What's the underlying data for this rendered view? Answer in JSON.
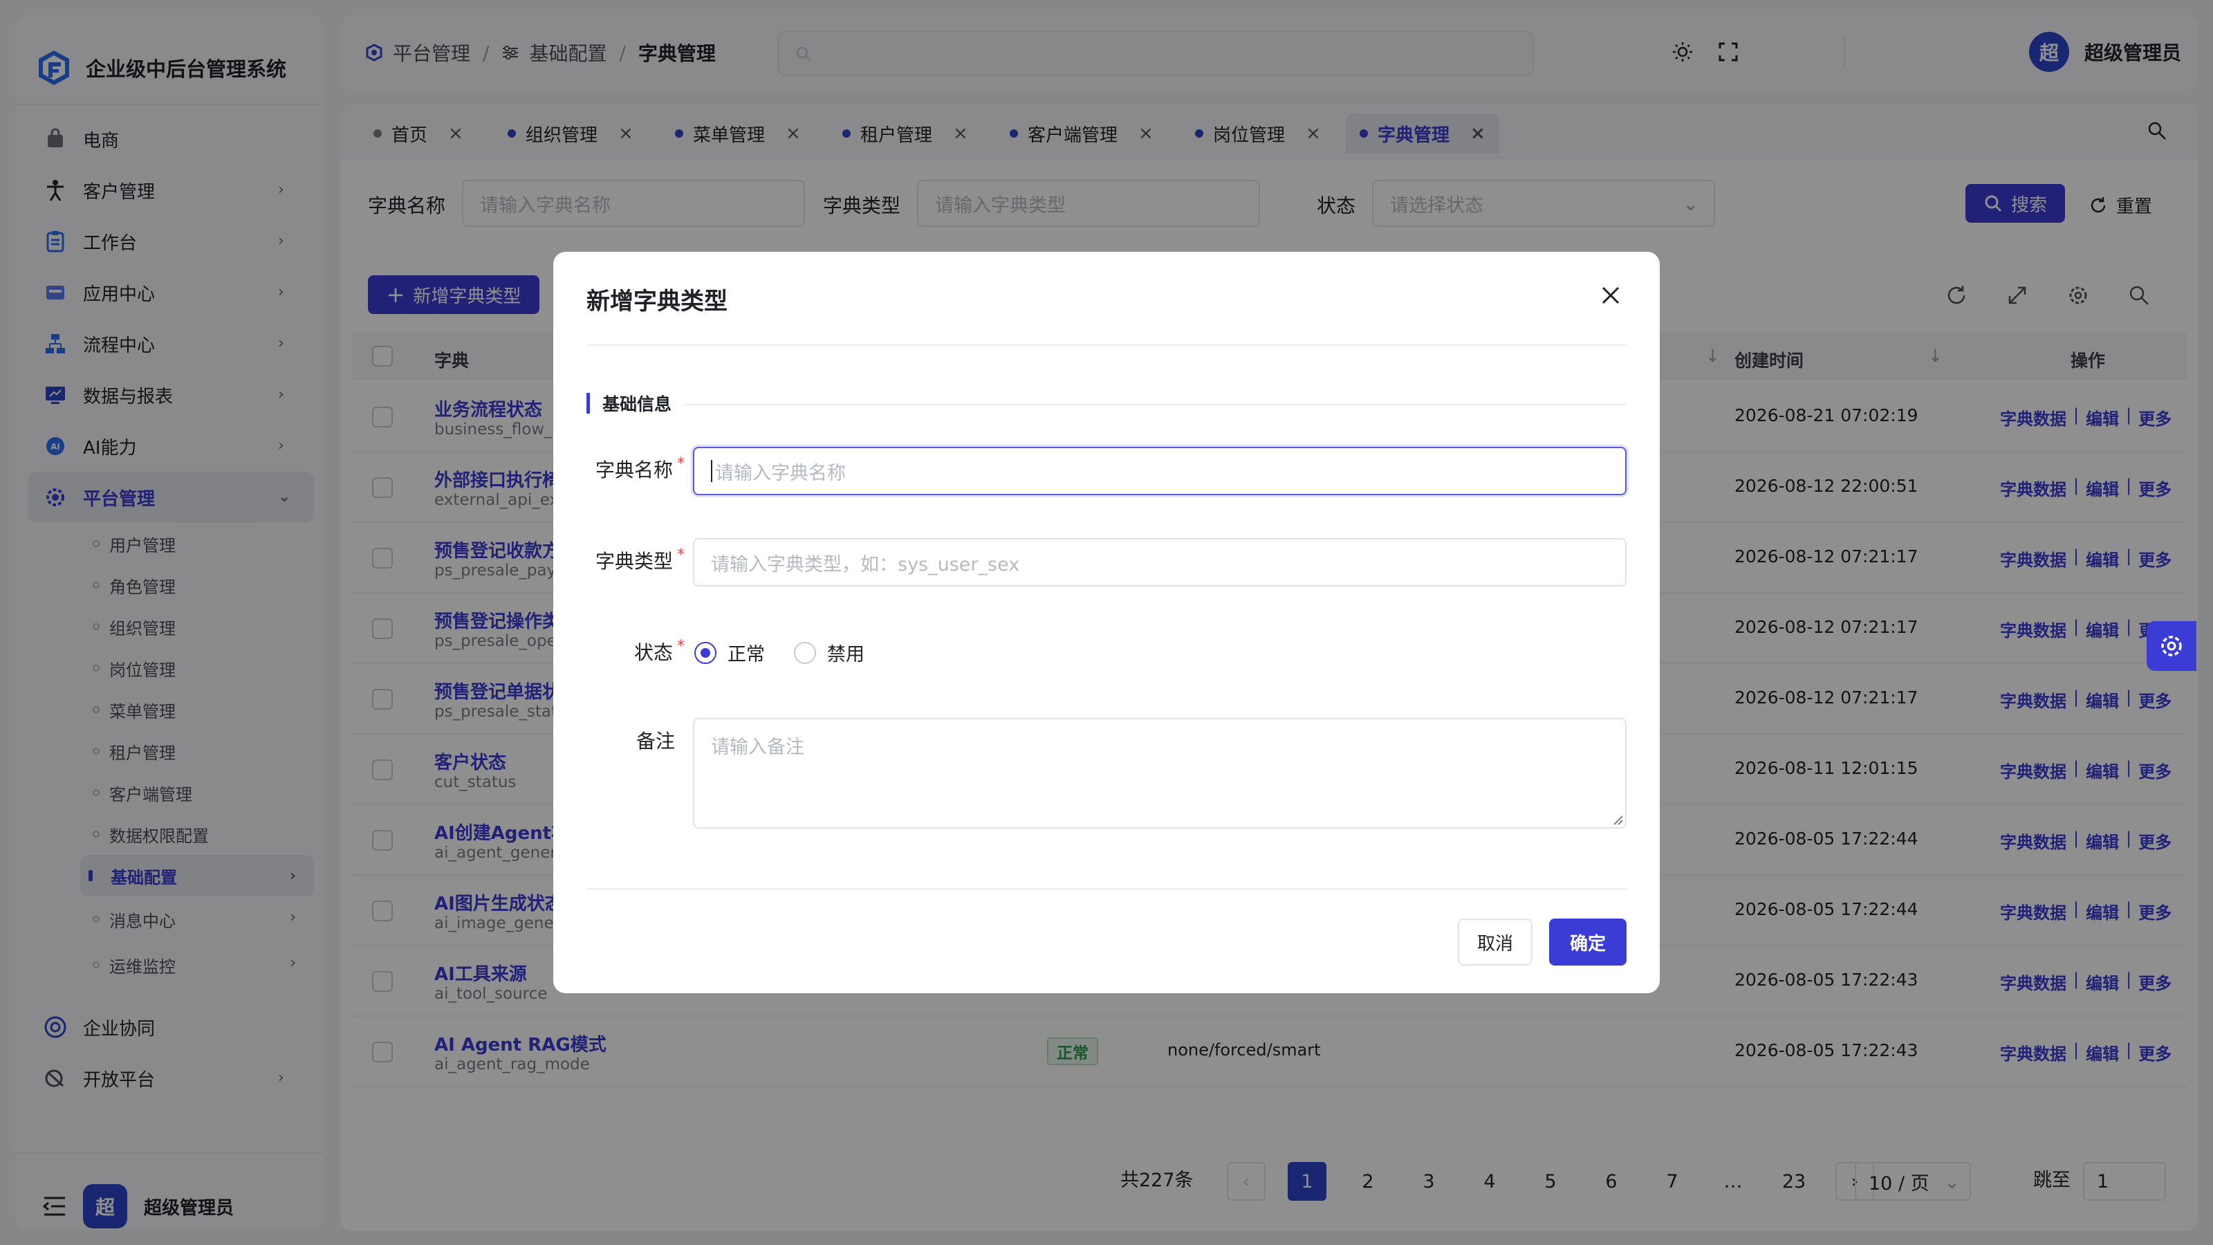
{
  "app": {
    "title": "企业级中后台管理系统"
  },
  "sidebar": {
    "items": [
      {
        "label": "电商",
        "icon": "bag-icon",
        "has_arrow": false
      },
      {
        "label": "客户管理",
        "icon": "person-icon",
        "has_arrow": true
      },
      {
        "label": "工作台",
        "icon": "clipboard-icon",
        "has_arrow": true
      },
      {
        "label": "应用中心",
        "icon": "app-icon",
        "has_arrow": true
      },
      {
        "label": "流程中心",
        "icon": "flow-icon",
        "has_arrow": true
      },
      {
        "label": "数据与报表",
        "icon": "chart-icon",
        "has_arrow": true
      },
      {
        "label": "AI能力",
        "icon": "ai-icon",
        "has_arrow": true
      },
      {
        "label": "平台管理",
        "icon": "gear-icon",
        "has_arrow": true,
        "expanded": true
      }
    ],
    "sub_items": [
      {
        "label": "用户管理"
      },
      {
        "label": "角色管理"
      },
      {
        "label": "组织管理"
      },
      {
        "label": "岗位管理"
      },
      {
        "label": "菜单管理"
      },
      {
        "label": "租户管理"
      },
      {
        "label": "客户端管理"
      },
      {
        "label": "数据权限配置"
      },
      {
        "label": "基础配置",
        "active": true,
        "has_arrow": true
      },
      {
        "label": "消息中心",
        "has_arrow": true
      },
      {
        "label": "运维监控",
        "has_arrow": true
      }
    ],
    "tail_items": [
      {
        "label": "企业协同",
        "icon": "collab-icon",
        "has_arrow": false
      },
      {
        "label": "开放平台",
        "icon": "open-icon",
        "has_arrow": true
      }
    ],
    "footer_user": {
      "avatar": "超",
      "name": "超级管理员"
    }
  },
  "header": {
    "breadcrumb": [
      "平台管理",
      "基础配置",
      "字典管理"
    ],
    "user": {
      "avatar": "超",
      "name": "超级管理员"
    }
  },
  "tabs": [
    {
      "label": "首页",
      "active": false
    },
    {
      "label": "组织管理",
      "active": false
    },
    {
      "label": "菜单管理",
      "active": false
    },
    {
      "label": "租户管理",
      "active": false
    },
    {
      "label": "客户端管理",
      "active": false
    },
    {
      "label": "岗位管理",
      "active": false
    },
    {
      "label": "字典管理",
      "active": true
    }
  ],
  "filter": {
    "name_label": "字典名称",
    "name_placeholder": "请输入字典名称",
    "type_label": "字典类型",
    "type_placeholder": "请输入字典类型",
    "status_label": "状态",
    "status_placeholder": "请选择状态",
    "search_label": "搜索",
    "reset_label": "重置"
  },
  "toolbar": {
    "add_label": "新增字典类型"
  },
  "table": {
    "columns": {
      "dict": "字典",
      "created": "创建时间",
      "ops": "操作"
    },
    "op_labels": [
      "字典数据",
      "编辑",
      "更多"
    ],
    "rows": [
      {
        "name": "业务流程状态",
        "code": "business_flow_s",
        "time": "2026-08-21 07:02:19"
      },
      {
        "name": "外部接口执行椅",
        "code": "external_api_ex",
        "time": "2026-08-12 22:00:51"
      },
      {
        "name": "预售登记收款方",
        "code": "ps_presale_pay",
        "time": "2026-08-12 07:21:17"
      },
      {
        "name": "预售登记操作类",
        "code": "ps_presale_ope",
        "time": "2026-08-12 07:21:17"
      },
      {
        "name": "预售登记单据状",
        "code": "ps_presale_stat",
        "time": "2026-08-12 07:21:17"
      },
      {
        "name": "客户状态",
        "code": "cut_status",
        "time": "2026-08-11 12:01:15"
      },
      {
        "name": "AI创建Agent状",
        "code": "ai_agent_gener",
        "time": "2026-08-05 17:22:44"
      },
      {
        "name": "AI图片生成状态",
        "code": "ai_image_gener",
        "time": "2026-08-05 17:22:44"
      },
      {
        "name": "AI工具来源",
        "code": "ai_tool_source",
        "time": "2026-08-05 17:22:43"
      },
      {
        "name": "AI Agent RAG模式",
        "code": "ai_agent_rag_mode",
        "time": "2026-08-05 17:22:43",
        "status": "正常",
        "value": "none/forced/smart"
      }
    ]
  },
  "pagination": {
    "total": "共227条",
    "pages": [
      "1",
      "2",
      "3",
      "4",
      "5",
      "6",
      "7",
      "…",
      "23"
    ],
    "current": "1",
    "page_size": "10 / 页",
    "jump_label": "跳至",
    "jump_value": "1"
  },
  "modal": {
    "title": "新增字典类型",
    "section": "基础信息",
    "name_label": "字典名称",
    "name_placeholder": "请输入字典名称",
    "type_label": "字典类型",
    "type_placeholder": "请输入字典类型，如：sys_user_sex",
    "status_label": "状态",
    "status_options": [
      "正常",
      "禁用"
    ],
    "status_selected": "正常",
    "remark_label": "备注",
    "remark_placeholder": "请输入备注",
    "cancel_label": "取消",
    "ok_label": "确定"
  },
  "colors": {
    "primary": "#3b3bd6",
    "brand": "#2d45c9",
    "danger": "#e54848",
    "success": "#2a9c4a"
  }
}
